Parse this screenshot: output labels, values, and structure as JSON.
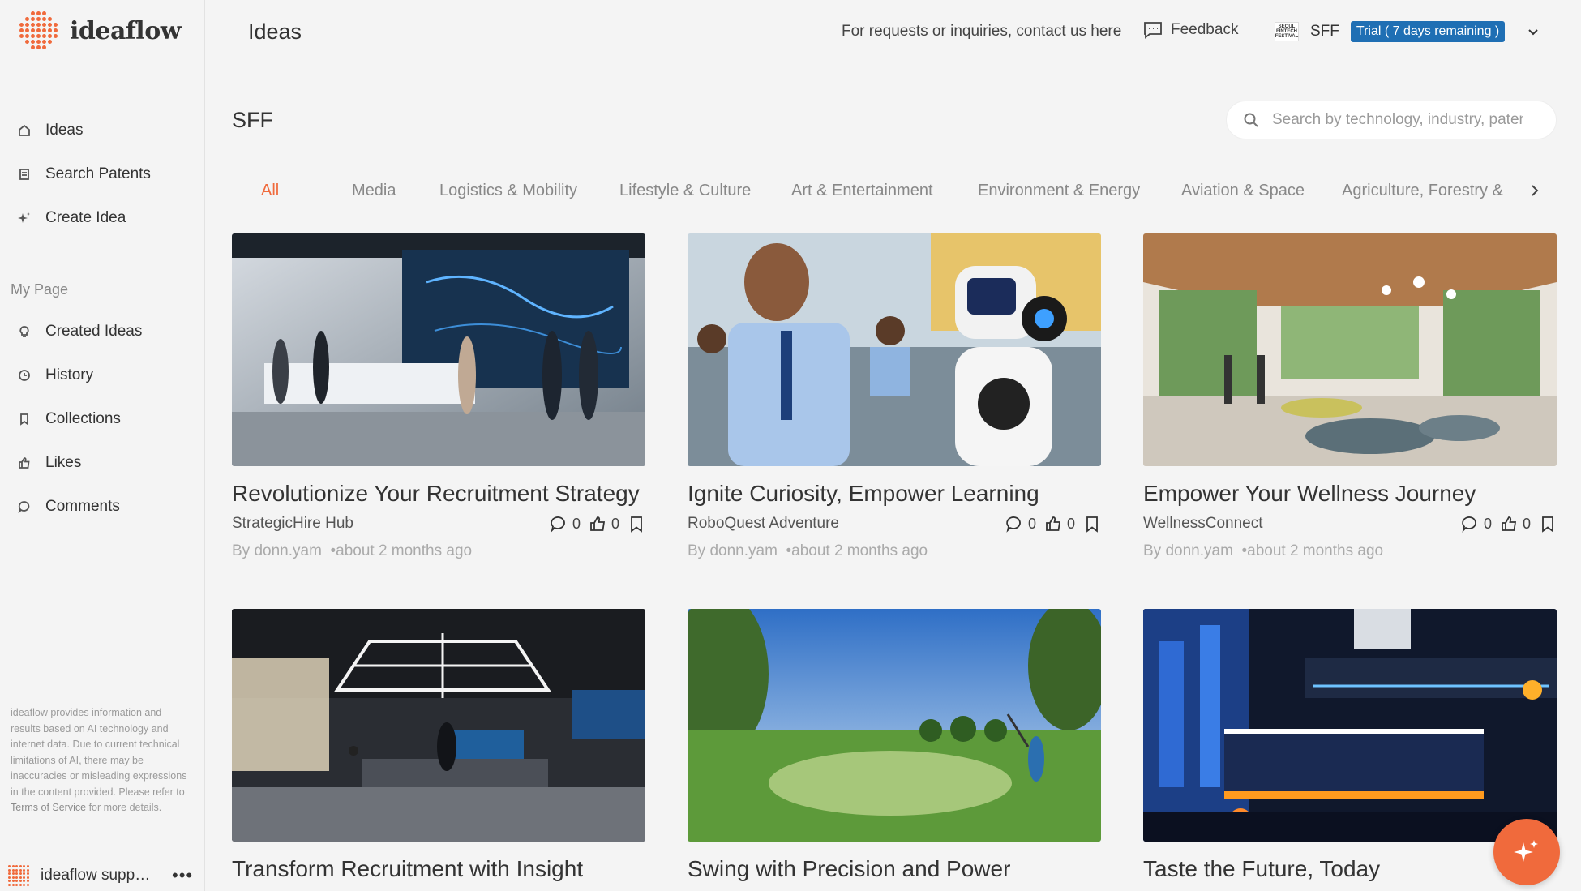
{
  "app": {
    "logo_text": "ideaflow"
  },
  "sidebar": {
    "items": [
      {
        "label": "Ideas",
        "icon": "home-icon"
      },
      {
        "label": "Search Patents",
        "icon": "document-icon"
      },
      {
        "label": "Create Idea",
        "icon": "sparkle-icon"
      }
    ],
    "section_label": "My Page",
    "my_items": [
      {
        "label": "Created Ideas",
        "icon": "lightbulb-icon"
      },
      {
        "label": "History",
        "icon": "clock-icon"
      },
      {
        "label": "Collections",
        "icon": "bookmark-icon"
      },
      {
        "label": "Likes",
        "icon": "thumbs-up-icon"
      },
      {
        "label": "Comments",
        "icon": "comment-icon"
      }
    ],
    "disclaimer": "ideaflow provides information and results based on AI technology and internet data. Due to current technical limitations of AI, there may be inaccuracies or misleading expressions in the content provided. Please refer to",
    "disclaimer_link": "Terms of Service",
    "disclaimer_end": "for more details.",
    "footer_name": "ideaflow support team",
    "more": "•••"
  },
  "header": {
    "title": "Ideas",
    "contact": "For requests or inquiries, contact us here",
    "feedback": "Feedback",
    "org_logo": "SEOUL FINTECH FESTIVAL",
    "org_name": "SFF",
    "trial": "Trial ( 7 days remaining )"
  },
  "main": {
    "heading": "SFF",
    "search_placeholder": "Search by technology, industry, patent",
    "tabs": [
      "All",
      "Media",
      "Logistics & Mobility",
      "Lifestyle & Culture",
      "Art & Entertainment",
      "Environment & Energy",
      "Aviation & Space",
      "Agriculture, Forestry &"
    ],
    "active_tab": "All",
    "cards": [
      {
        "title": "Revolutionize Your Recruitment Strategy",
        "sub": "StrategicHire Hub",
        "comments": "0",
        "likes": "0",
        "author": "By donn.yam",
        "time": "•about 2 months ago"
      },
      {
        "title": "Ignite Curiosity, Empower Learning",
        "sub": "RoboQuest Adventure",
        "comments": "0",
        "likes": "0",
        "author": "By donn.yam",
        "time": "•about 2 months ago"
      },
      {
        "title": "Empower Your Wellness Journey",
        "sub": "WellnessConnect",
        "comments": "0",
        "likes": "0",
        "author": "By donn.yam",
        "time": "•about 2 months ago"
      },
      {
        "title": "Transform Recruitment with Insight"
      },
      {
        "title": "Swing with Precision and Power"
      },
      {
        "title": "Taste the Future, Today"
      }
    ]
  },
  "colors": {
    "accent": "#f06a3c",
    "trial_bg": "#1f6fb4"
  }
}
